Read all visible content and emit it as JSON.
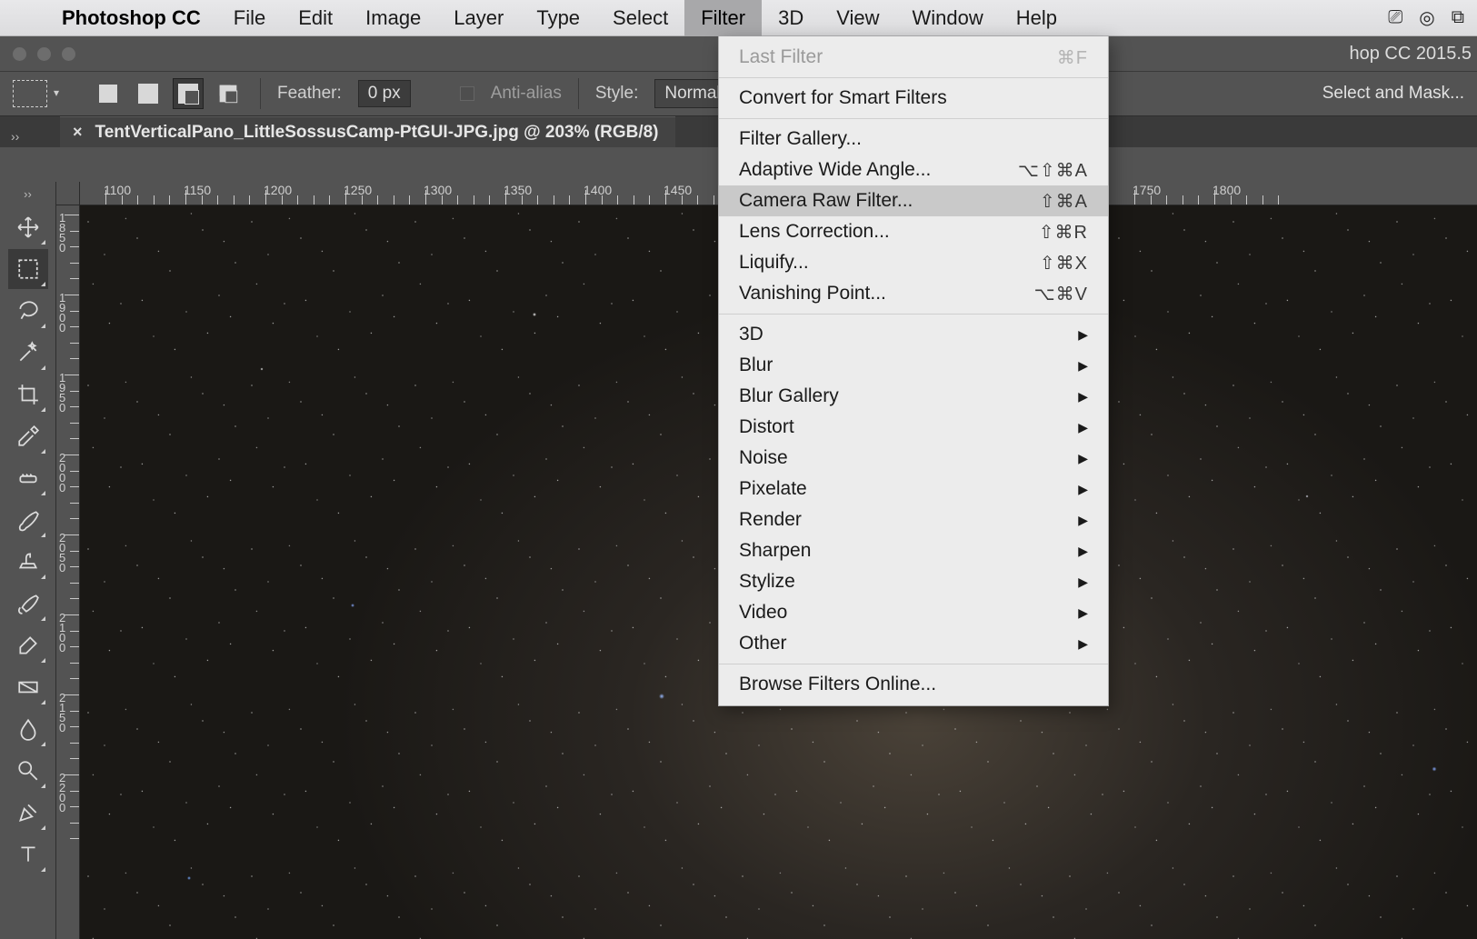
{
  "menubar": {
    "app_name": "Photoshop CC",
    "items": [
      "File",
      "Edit",
      "Image",
      "Layer",
      "Type",
      "Select",
      "Filter",
      "3D",
      "View",
      "Window",
      "Help"
    ],
    "active_index": 6
  },
  "window": {
    "title_suffix": "hop CC 2015.5"
  },
  "optionsbar": {
    "feather_label": "Feather:",
    "feather_value": "0 px",
    "antialias_label": "Anti-alias",
    "style_label": "Style:",
    "style_value": "Normal",
    "mask_button": "Select and Mask..."
  },
  "document": {
    "tab_title": "TentVerticalPano_LittleSossusCamp-PtGUI-JPG.jpg @ 203% (RGB/8)"
  },
  "ruler": {
    "h_labels": [
      "1100",
      "1150",
      "1200",
      "1250",
      "1300",
      "1350",
      "1400",
      "1450",
      "1750",
      "1800"
    ],
    "v_labels": [
      "1850",
      "1900",
      "1950",
      "2000",
      "2050",
      "2100",
      "2150",
      "2200"
    ]
  },
  "filter_menu": {
    "last_filter": {
      "label": "Last Filter",
      "shortcut": "⌘F",
      "disabled": true
    },
    "convert": {
      "label": "Convert for Smart Filters"
    },
    "group1": [
      {
        "label": "Filter Gallery..."
      },
      {
        "label": "Adaptive Wide Angle...",
        "shortcut": "⌥⇧⌘A"
      },
      {
        "label": "Camera Raw Filter...",
        "shortcut": "⇧⌘A",
        "highlight": true
      },
      {
        "label": "Lens Correction...",
        "shortcut": "⇧⌘R"
      },
      {
        "label": "Liquify...",
        "shortcut": "⇧⌘X"
      },
      {
        "label": "Vanishing Point...",
        "shortcut": "⌥⌘V"
      }
    ],
    "group2": [
      {
        "label": "3D",
        "submenu": true
      },
      {
        "label": "Blur",
        "submenu": true
      },
      {
        "label": "Blur Gallery",
        "submenu": true
      },
      {
        "label": "Distort",
        "submenu": true
      },
      {
        "label": "Noise",
        "submenu": true
      },
      {
        "label": "Pixelate",
        "submenu": true
      },
      {
        "label": "Render",
        "submenu": true
      },
      {
        "label": "Sharpen",
        "submenu": true
      },
      {
        "label": "Stylize",
        "submenu": true
      },
      {
        "label": "Video",
        "submenu": true
      },
      {
        "label": "Other",
        "submenu": true
      }
    ],
    "browse": {
      "label": "Browse Filters Online..."
    }
  }
}
